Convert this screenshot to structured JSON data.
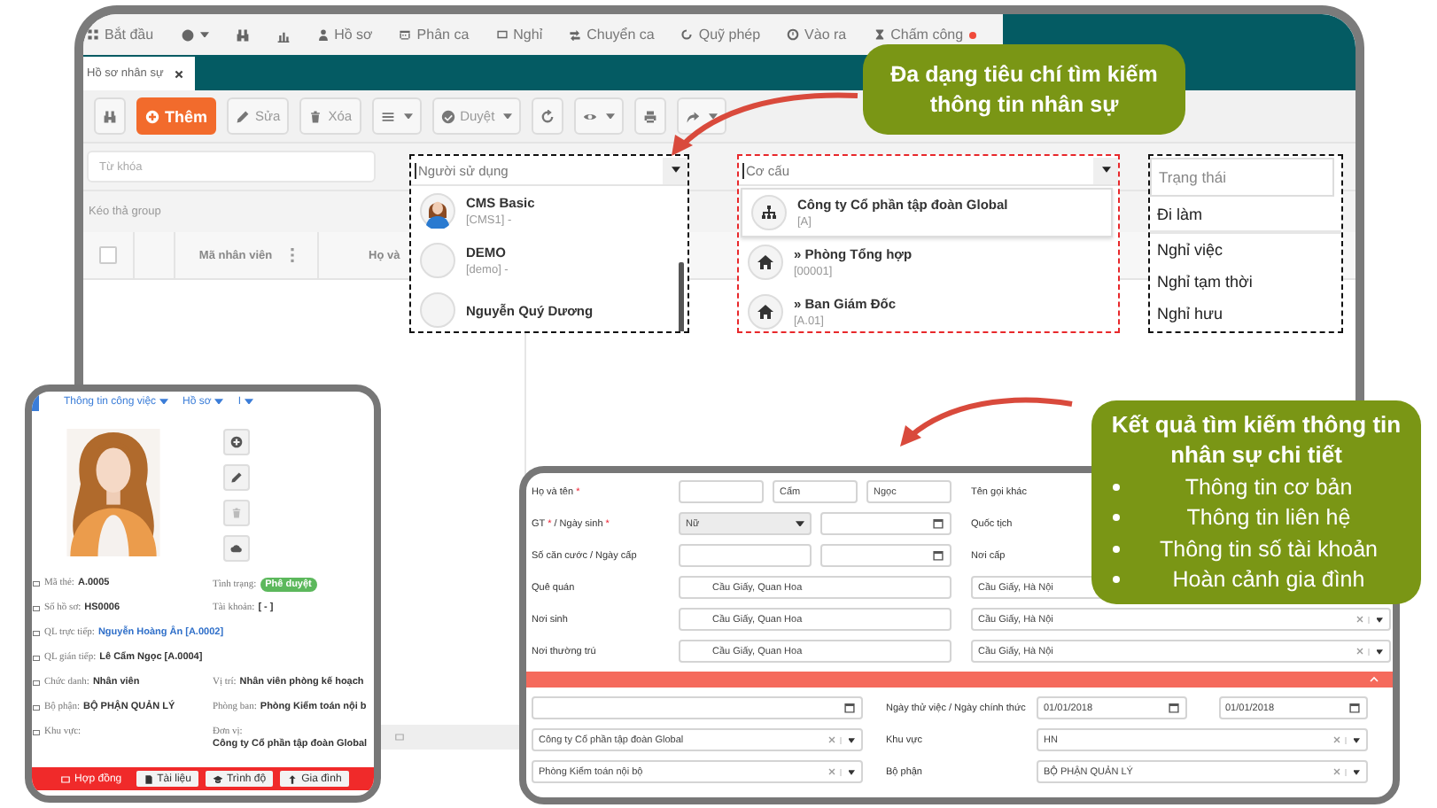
{
  "main_window": {
    "menu": [
      {
        "kind": "labeled",
        "label": "Bắt đầu"
      },
      {
        "kind": "icon_dropdown"
      },
      {
        "kind": "icon_only"
      },
      {
        "kind": "icon_only"
      },
      {
        "kind": "labeled",
        "label": "Hồ sơ"
      },
      {
        "kind": "labeled",
        "label": "Phân ca"
      },
      {
        "kind": "labeled",
        "label": "Nghỉ"
      },
      {
        "kind": "labeled",
        "label": "Chuyển ca"
      },
      {
        "kind": "labeled",
        "label": "Quỹ phép"
      },
      {
        "kind": "labeled",
        "label": "Vào ra"
      },
      {
        "kind": "labeled",
        "label": "Chấm công",
        "notification": true
      }
    ],
    "tab": {
      "label": "Hồ sơ nhân sự"
    },
    "toolbar": [
      {
        "kind": "icon"
      },
      {
        "kind": "primary",
        "label": "Thêm"
      },
      {
        "kind": "default",
        "label": "Sửa"
      },
      {
        "kind": "default",
        "label": "Xóa"
      },
      {
        "kind": "menu"
      },
      {
        "kind": "split",
        "label": "Duyệt"
      },
      {
        "kind": "icon"
      },
      {
        "kind": "menu"
      },
      {
        "kind": "icon"
      },
      {
        "kind": "menu"
      }
    ],
    "keyword_field": {
      "placeholder": "Từ khóa"
    },
    "user_filter": {
      "placeholder": "Người sử dụng",
      "color": "#111111",
      "options": [
        {
          "name": "CMS Basic",
          "code": "[CMS1] -",
          "kind": "photo"
        },
        {
          "name": "DEMO",
          "code": "[demo] -",
          "kind": "blank"
        },
        {
          "name": "Nguyễn Quý Dương",
          "kind": "blank"
        }
      ]
    },
    "structure_filter": {
      "placeholder": "Cơ cấu",
      "color": "#e8282b",
      "options": [
        {
          "name": "Công ty Cổ phần tập đoàn Global",
          "code": "[A]",
          "kind": "company",
          "selected": true
        },
        {
          "name": "» Phòng Tổng hợp",
          "code": "[00001]",
          "kind": "department",
          "selected": false
        },
        {
          "name": "» Ban Giám Đốc",
          "code": "[A.01]",
          "kind": "department",
          "selected": false
        }
      ]
    },
    "status_filter": {
      "placeholder": "Trạng thái",
      "color": "#111111",
      "options": [
        {
          "label": "Đi làm",
          "selected": true
        },
        {
          "label": "Nghỉ việc",
          "selected": false
        },
        {
          "label": "Nghỉ tạm thời",
          "selected": false
        },
        {
          "label": "Nghỉ hưu",
          "selected": false
        }
      ]
    },
    "group_hint": "Kéo thả group",
    "header_checkbox": {
      "checked": false
    },
    "columns": [
      {
        "label": "Mã nhân viên"
      },
      {
        "label": "Họ và"
      }
    ],
    "callout": "Đa dạng tiêu chí tìm kiếm thông tin nhân sự"
  },
  "profile_card": {
    "tabs": [
      {
        "label": "Thông tin công việc"
      },
      {
        "label": "Hồ sơ"
      },
      {
        "label": "I"
      }
    ],
    "info_rows": [
      {
        "left": {
          "label": "Mã thẻ:",
          "value": "A.0005"
        },
        "right": {
          "label": "Tình trạng:",
          "value": "Phê duyệt",
          "kind": "badge"
        }
      },
      {
        "left": {
          "label": "Số hồ sơ:",
          "value": "HS0006"
        },
        "right": {
          "label": "Tài khoản:",
          "value": "[ - ]"
        }
      },
      {
        "left": {
          "label": "QL trực tiếp:",
          "value": "Nguyễn Hoàng Ân [A.0002]",
          "kind": "link"
        }
      },
      {
        "left": {
          "label": "QL gián tiếp:",
          "value": "Lê Cẩm Ngọc [A.0004]"
        }
      },
      {
        "left": {
          "label": "Chức danh:",
          "value": "Nhân viên"
        },
        "right": {
          "label": "Vị trí:",
          "value": "Nhân viên phòng kế hoạch"
        }
      },
      {
        "left": {
          "label": "Bộ phận:",
          "value": "BỘ PHẬN QUẢN LÝ"
        },
        "right": {
          "label": "Phòng ban:",
          "value": "Phòng Kiểm toán nội b"
        }
      },
      {
        "left": {
          "label": "Khu vực:"
        },
        "right": {
          "label": "Đơn vị:",
          "value": "Công ty Cổ phần tập đoàn Global"
        }
      }
    ],
    "bottom_tabs": [
      {
        "label": "Hợp đồng",
        "selected": true
      },
      {
        "label": "Tài liệu",
        "selected": false
      },
      {
        "label": "Trình độ",
        "selected": false
      },
      {
        "label": "Gia đình",
        "selected": false
      }
    ]
  },
  "detail_form": {
    "personal_rows": [
      {
        "label": [
          {
            "text": "Họ và tên "
          },
          {
            "text": "*",
            "kind": "required"
          }
        ],
        "fields": [
          {
            "kind": "input"
          },
          {
            "kind": "input",
            "value": "Cẩm"
          },
          {
            "kind": "input",
            "value": "Ngọc"
          }
        ],
        "side": {
          "kind": "label",
          "text": "Tên gọi khác"
        }
      },
      {
        "label": [
          {
            "text": "GT "
          },
          {
            "text": "*",
            "kind": "required"
          },
          {
            "text": " / Ngày sinh "
          },
          {
            "text": "*",
            "kind": "required"
          }
        ],
        "fields": [
          {
            "kind": "select",
            "value": "Nữ"
          },
          {
            "kind": "date"
          }
        ],
        "side": {
          "kind": "label",
          "text": "Quốc tịch"
        }
      },
      {
        "label": [
          {
            "text": "Số căn cước / Ngày cấp"
          }
        ],
        "fields": [
          {
            "kind": "input"
          },
          {
            "kind": "date"
          }
        ],
        "side": {
          "kind": "label",
          "text": "Nơi cấp"
        }
      },
      {
        "label": [
          {
            "text": "Quê quán"
          }
        ],
        "fields": [
          {
            "kind": "input",
            "value": "Cầu Giấy, Quan Hoa"
          }
        ],
        "side": {
          "kind": "combo",
          "text": "Cầu Giấy, Hà Nội"
        }
      },
      {
        "label": [
          {
            "text": "Nơi sinh"
          }
        ],
        "fields": [
          {
            "kind": "input",
            "value": "Cầu Giấy, Quan Hoa"
          }
        ],
        "side": {
          "kind": "combo",
          "text": "Cầu Giấy, Hà Nội"
        }
      },
      {
        "label": [
          {
            "text": "Nơi thường trú"
          }
        ],
        "fields": [
          {
            "kind": "input",
            "value": "Cầu Giấy, Quan Hoa"
          }
        ],
        "side": {
          "kind": "combo",
          "text": "Cầu Giấy, Hà Nội"
        }
      }
    ],
    "section_bar": {
      "expanded": true
    },
    "work_rows": [
      {
        "left": {
          "kind": "date"
        },
        "label": "Ngày thử việc / Ngày chính thức",
        "fields": [
          {
            "kind": "date",
            "value": "01/01/2018"
          },
          {
            "kind": "date",
            "value": "01/01/2018"
          }
        ]
      },
      {
        "left": {
          "kind": "combo",
          "value": "Công ty Cổ phần tập đoàn Global"
        },
        "label": "Khu vực",
        "fields": [
          {
            "kind": "combo",
            "value": "HN"
          }
        ]
      },
      {
        "left": {
          "kind": "combo",
          "value": "Phòng Kiểm toán nội bộ"
        },
        "label": "Bộ phận",
        "fields": [
          {
            "kind": "combo",
            "value": "BỘ PHẬN QUẢN LÝ"
          }
        ]
      }
    ]
  },
  "result_callout": {
    "title": "Kết quả tìm kiếm thông tin nhân sự chi tiết",
    "bullets": [
      "Thông tin cơ bản",
      "Thông tin liên hệ",
      "Thông tin số tài khoản",
      "Hoàn cảnh gia đình"
    ]
  }
}
